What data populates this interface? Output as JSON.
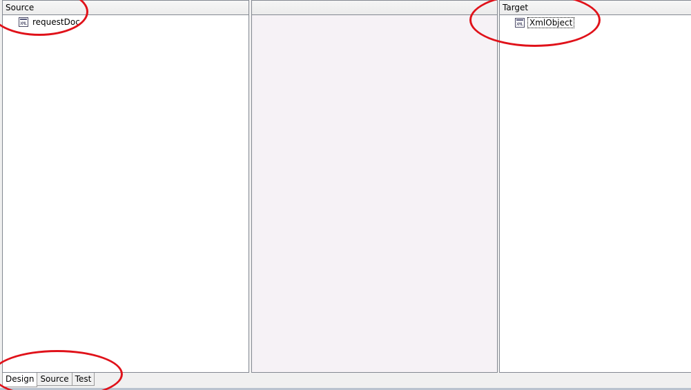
{
  "panes": {
    "source": {
      "header": "Source",
      "item": "requestDoc"
    },
    "middle": {
      "header": ""
    },
    "target": {
      "header": "Target",
      "item": "XmlObject"
    }
  },
  "icon": {
    "xml_text": "XML",
    "name": "xml-document-icon"
  },
  "tabs": [
    {
      "label": "Design",
      "active": true
    },
    {
      "label": "Source",
      "active": false
    },
    {
      "label": "Test",
      "active": false
    }
  ],
  "colors": {
    "annotation": "#e0121a",
    "middle_pane": "#f6f2f6"
  }
}
